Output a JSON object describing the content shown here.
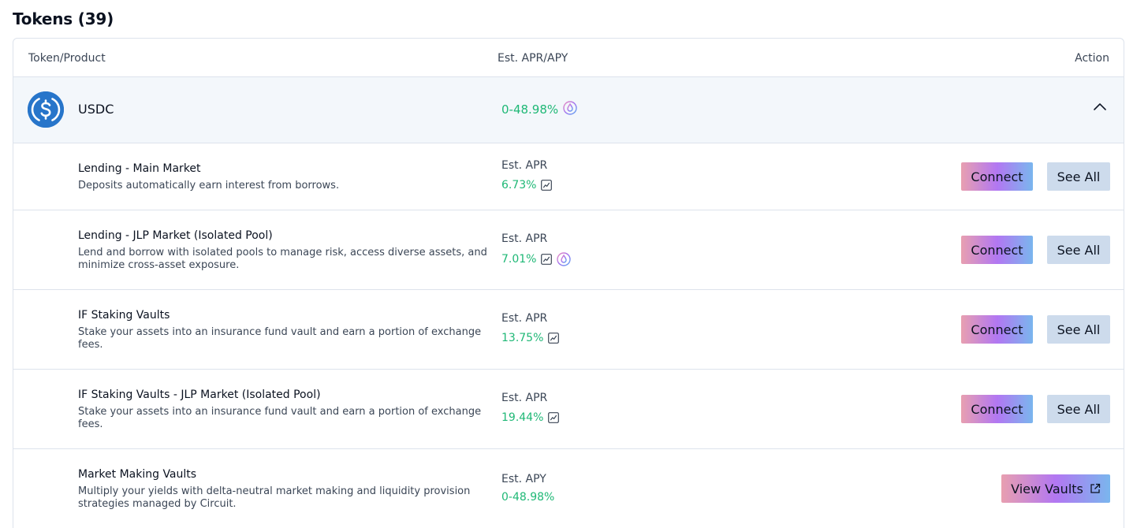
{
  "page": {
    "title": "Tokens (39)"
  },
  "table": {
    "headers": {
      "token": "Token/Product",
      "apr": "Est. APR/APY",
      "action": "Action"
    }
  },
  "token": {
    "name": "USDC",
    "apr_range": "0-48.98%",
    "logo_icon": "usdc-logo-icon",
    "collapse_icon": "chevron-up-icon"
  },
  "products": [
    {
      "title": "Lending - Main Market",
      "desc": "Deposits automatically earn interest from borrows.",
      "est_label": "Est. APR",
      "value": "6.73%",
      "connect_label": "Connect",
      "see_all_label": "See All"
    },
    {
      "title": "Lending - JLP Market (Isolated Pool)",
      "desc": "Lend and borrow with isolated pools to manage risk, access diverse assets, and minimize cross-asset exposure.",
      "est_label": "Est. APR",
      "value": "7.01%",
      "connect_label": "Connect",
      "see_all_label": "See All"
    },
    {
      "title": "IF Staking Vaults",
      "desc": "Stake your assets into an insurance fund vault and earn a portion of exchange fees.",
      "est_label": "Est. APR",
      "value": "13.75%",
      "connect_label": "Connect",
      "see_all_label": "See All"
    },
    {
      "title": "IF Staking Vaults - JLP Market (Isolated Pool)",
      "desc": "Stake your assets into an insurance fund vault and earn a portion of exchange fees.",
      "est_label": "Est. APR",
      "value": "19.44%",
      "connect_label": "Connect",
      "see_all_label": "See All"
    },
    {
      "title": "Market Making Vaults",
      "desc": "Multiply your yields with delta-neutral market making and liquidity provision strategies managed by Circuit.",
      "est_label": "Est. APY",
      "value": "0-48.98%",
      "vaults_label": "View Vaults"
    }
  ],
  "colors": {
    "positive": "#1fb876",
    "usdc_blue": "#2775ca",
    "see_all_bg": "#cddbec",
    "row_highlight": "#f3f7fb"
  }
}
